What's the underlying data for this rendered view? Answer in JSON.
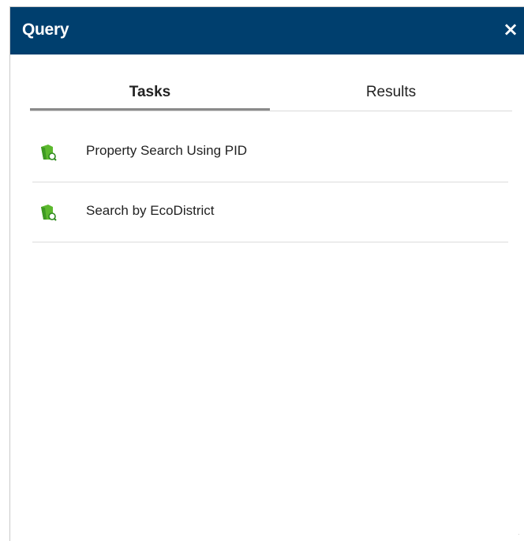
{
  "window": {
    "title": "Query",
    "close_label": "×"
  },
  "tabs": [
    {
      "label": "Tasks",
      "active": true
    },
    {
      "label": "Results",
      "active": false
    }
  ],
  "tasks": [
    {
      "label": "Property Search Using PID",
      "icon": "query-task-icon"
    },
    {
      "label": "Search by EcoDistrict",
      "icon": "query-task-icon"
    }
  ],
  "colors": {
    "header_bg": "#003f6e",
    "icon_green": "#5cb82e",
    "icon_dark_green": "#2f8a1f"
  }
}
